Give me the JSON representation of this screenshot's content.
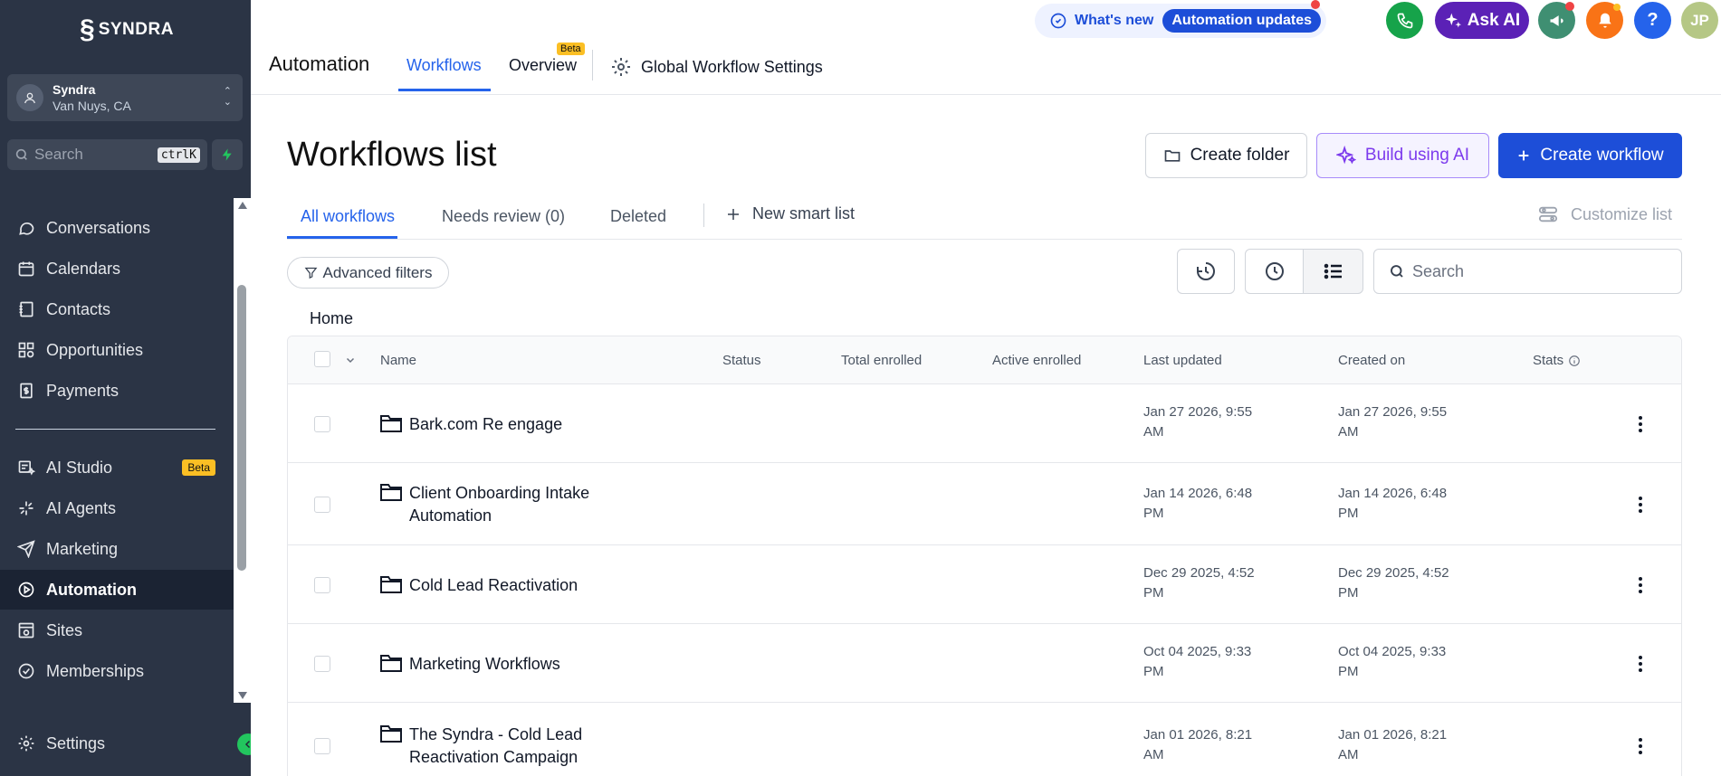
{
  "app": {
    "logo_text": "SYNDRA",
    "colors": {
      "sidebar_bg": "#2b3445",
      "accent": "#2563eb",
      "primary_button": "#1d4ed8",
      "ai_purple": "#7c3aed",
      "beta_badge": "#fbbf24",
      "sidebar_active": "#1b2333"
    }
  },
  "sidebar": {
    "account": {
      "name": "Syndra",
      "location": "Van Nuys, CA"
    },
    "search": {
      "placeholder": "Search",
      "shortcut": "ctrlK"
    },
    "items": [
      {
        "label": "Conversations",
        "icon": "chat-bubble-icon"
      },
      {
        "label": "Calendars",
        "icon": "calendar-icon"
      },
      {
        "label": "Contacts",
        "icon": "contacts-book-icon"
      },
      {
        "label": "Opportunities",
        "icon": "opportunities-icon"
      },
      {
        "label": "Payments",
        "icon": "dollar-doc-icon"
      },
      {
        "label": "AI Studio",
        "icon": "ai-studio-icon",
        "badge": "Beta"
      },
      {
        "label": "AI Agents",
        "icon": "sparkle-icon"
      },
      {
        "label": "Marketing",
        "icon": "send-icon"
      },
      {
        "label": "Automation",
        "icon": "play-circle-icon",
        "active": true
      },
      {
        "label": "Sites",
        "icon": "globe-page-icon"
      },
      {
        "label": "Memberships",
        "icon": "badge-icon"
      }
    ],
    "settings_label": "Settings"
  },
  "header": {
    "title": "Automation",
    "tabs": [
      {
        "label": "Workflows",
        "active": true
      },
      {
        "label": "Overview",
        "badge": "Beta"
      }
    ],
    "global_settings_label": "Global Workflow Settings",
    "whats_new_label": "What's new",
    "automation_updates_label": "Automation updates",
    "ask_ai_label": "Ask AI",
    "help_label": "?",
    "user_initials": "JP"
  },
  "main": {
    "page_title": "Workflows list",
    "buttons": {
      "create_folder": "Create folder",
      "build_ai": "Build using AI",
      "create_workflow": "Create workflow"
    },
    "subtabs": [
      {
        "label": "All workflows",
        "active": true
      },
      {
        "label": "Needs review (0)"
      },
      {
        "label": "Deleted"
      }
    ],
    "new_smart_list_label": "New smart list",
    "customize_list_label": "Customize list",
    "advanced_filters_label": "Advanced filters",
    "search_placeholder": "Search",
    "breadcrumb": "Home",
    "table": {
      "columns": [
        "Name",
        "Status",
        "Total enrolled",
        "Active enrolled",
        "Last updated",
        "Created on",
        "Stats"
      ],
      "rows": [
        {
          "name": "Bark.com Re engage",
          "last_updated": "Jan 27 2026, 9:55 AM",
          "created_on": "Jan 27 2026, 9:55 AM"
        },
        {
          "name": "Client Onboarding Intake Automation",
          "last_updated": "Jan 14 2026, 6:48 PM",
          "created_on": "Jan 14 2026, 6:48 PM"
        },
        {
          "name": "Cold Lead Reactivation",
          "last_updated": "Dec 29 2025, 4:52 PM",
          "created_on": "Dec 29 2025, 4:52 PM"
        },
        {
          "name": "Marketing Workflows",
          "last_updated": "Oct 04 2025, 9:33 PM",
          "created_on": "Oct 04 2025, 9:33 PM"
        },
        {
          "name": "The Syndra - Cold Lead Reactivation Campaign",
          "last_updated": "Jan 01 2026, 8:21 AM",
          "created_on": "Jan 01 2026, 8:21 AM"
        }
      ]
    }
  }
}
